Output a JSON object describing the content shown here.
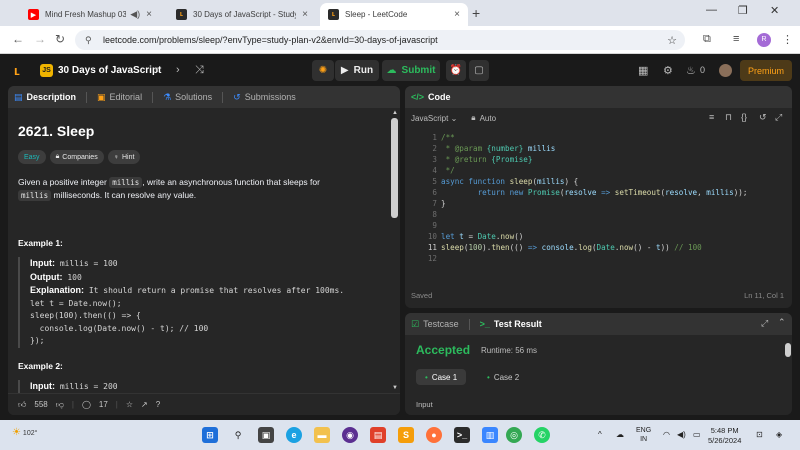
{
  "browser": {
    "tabs": [
      {
        "title": "Mind Fresh Mashup 03",
        "favicon": "youtube-icon",
        "active": false
      },
      {
        "title": "30 Days of JavaScript - Study Pl",
        "favicon": "leetcode-icon",
        "active": false
      },
      {
        "title": "Sleep - LeetCode",
        "favicon": "leetcode-icon",
        "active": true
      }
    ],
    "url": "leetcode.com/problems/sleep/?envType=study-plan-v2&envId=30-days-of-javascript",
    "profile_initial": "R"
  },
  "header": {
    "badge": "JS",
    "plan_title": "30 Days of JavaScript",
    "run_label": "Run",
    "submit_label": "Submit",
    "streak": "0",
    "premium_label": "Premium"
  },
  "left_tabs": [
    {
      "label": "Description",
      "active": true
    },
    {
      "label": "Editorial",
      "active": false
    },
    {
      "label": "Solutions",
      "active": false
    },
    {
      "label": "Submissions",
      "active": false
    }
  ],
  "problem": {
    "title": "2621. Sleep",
    "difficulty": "Easy",
    "tag_companies": "Companies",
    "tag_hint": "Hint",
    "desc_pre": "Given a positive integer ",
    "desc_code1": "millis",
    "desc_mid": ", write an asynchronous function that sleeps for",
    "desc_code2": "millis",
    "desc_post": " milliseconds. It can resolve any value.",
    "example1": {
      "heading": "Example 1:",
      "input_label": "Input:",
      "input": "millis = 100",
      "output_label": "Output:",
      "output": "100",
      "expl_label": "Explanation:",
      "expl": "It should return a promise that resolves after 100ms.",
      "code": [
        "let t = Date.now();",
        "sleep(100).then(() => {",
        "  console.log(Date.now() - t); // 100",
        "});"
      ]
    },
    "example2": {
      "heading": "Example 2:",
      "input_label": "Input:",
      "input": "millis = 200"
    }
  },
  "footer": {
    "likes": "558",
    "comments": "17"
  },
  "code_panel": {
    "title": "Code",
    "language": "JavaScript",
    "mode": "Auto",
    "saved": "Saved",
    "cursor": "Ln 11, Col 1",
    "line_numbers": [
      "1",
      "2",
      "3",
      "4",
      "5",
      "6",
      "7",
      "8",
      "9",
      "10",
      "11",
      "12"
    ]
  },
  "result_panel": {
    "tab_testcase": "Testcase",
    "tab_result": "Test Result",
    "status": "Accepted",
    "runtime": "Runtime: 56 ms",
    "case1": "Case 1",
    "case2": "Case 2",
    "input_label": "Input"
  },
  "taskbar": {
    "weather": "102°",
    "lang1": "ENG",
    "lang2": "IN",
    "time": "5:48 PM",
    "date": "5/26/2024"
  },
  "colors": {
    "accent": "#ffa116",
    "accepted": "#2cbb5d",
    "easy": "#1cbaba"
  }
}
